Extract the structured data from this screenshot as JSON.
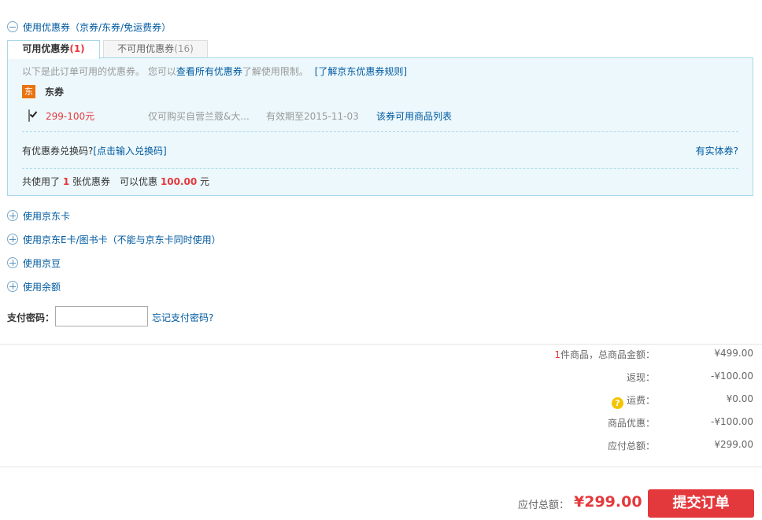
{
  "coupon_section": {
    "toggle_label": "使用优惠券（京券/东券/免运费券）",
    "tabs": [
      {
        "label": "可用优惠券",
        "count": "(1)"
      },
      {
        "label": "不可用优惠券",
        "count": "(16)"
      }
    ],
    "intro_prefix": "以下是此订单可用的优惠券。 您可以",
    "intro_link": "查看所有优惠券",
    "intro_suffix": "了解使用限制。",
    "rules_link": "[了解京东优惠券规则]",
    "group_badge": "东",
    "group_title": "东券",
    "coupon": {
      "checked": true,
      "amount": "299-100元",
      "scope": "仅可购买自营兰蔻&大...",
      "validity": "有效期至2015-11-03",
      "product_link": "该券可用商品列表"
    },
    "redeem_label": "有优惠券兑换码?",
    "redeem_link": "[点击输入兑换码]",
    "physical_link": "有实体券?",
    "summary_prefix": "共使用了",
    "summary_count": "1",
    "summary_mid": "张优惠券　可以优惠",
    "summary_amount": "100.00",
    "summary_unit": "元"
  },
  "options": [
    {
      "label": "使用京东卡"
    },
    {
      "label": "使用京东E卡/图书卡（不能与京东卡同时使用）"
    },
    {
      "label": "使用京豆"
    },
    {
      "label": "使用余额"
    }
  ],
  "payment_password": {
    "label": "支付密码：",
    "value": "",
    "forgot_link": "忘记支付密码?"
  },
  "totals": {
    "item_count": "1",
    "item_label": "件商品，总商品金额：",
    "item_value": "¥499.00",
    "rebate_label": "返现：",
    "rebate_value": "-¥100.00",
    "shipping_label": "运费：",
    "shipping_value": "¥0.00",
    "discount_label": "商品优惠：",
    "discount_value": "-¥100.00",
    "due_label": "应付总额：",
    "due_value": "¥299.00"
  },
  "footer": {
    "total_label": "应付总额：",
    "total_value": "¥299.00",
    "submit_label": "提交订单"
  },
  "colors": {
    "accent_red": "#e4393c",
    "link_blue": "#005aa0",
    "panel_bg": "#edf8fc",
    "panel_border": "#a8d8e8"
  }
}
